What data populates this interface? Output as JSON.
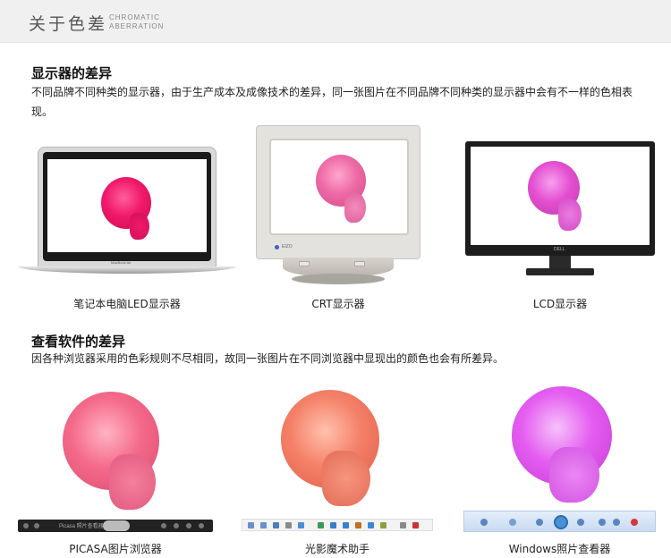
{
  "header": {
    "title_cn": "关于色差",
    "title_en_line1": "CHROMATIC",
    "title_en_line2": "ABERRATION"
  },
  "section1": {
    "title": "显示器的差异",
    "description": "不同品牌不同种类的显示器，由于生产成本及成像技术的差异，同一张图片在不同品牌不同种类的显示器中会有不一样的色相表现。",
    "monitors": [
      {
        "label": "笔记本电脑LED显示器",
        "rose_color": "#f0196a",
        "brand": "MacBook Air"
      },
      {
        "label": "CRT显示器",
        "rose_color": "#ee6aa6",
        "brand": "EIZO"
      },
      {
        "label": "LCD显示器",
        "rose_color": "#e44fd0",
        "brand": "DELL"
      }
    ]
  },
  "section2": {
    "title": "查看软件的差异",
    "description": "因各种浏览器采用的色彩规则不尽相同，故同一张图片在不同浏览器中显现出的颜色也会有所差异。",
    "viewers": [
      {
        "label": "PICASA图片浏览器",
        "rose_color": "#f46a8a",
        "toolbar_text": "Picasa 照片查看器"
      },
      {
        "label": "光影魔术助手",
        "rose_color": "#f58068"
      },
      {
        "label": "Windows照片查看器",
        "rose_color": "#e45cf0"
      }
    ]
  },
  "colors": {
    "header_bg": "#f0f0f0",
    "title_text": "#111111"
  }
}
